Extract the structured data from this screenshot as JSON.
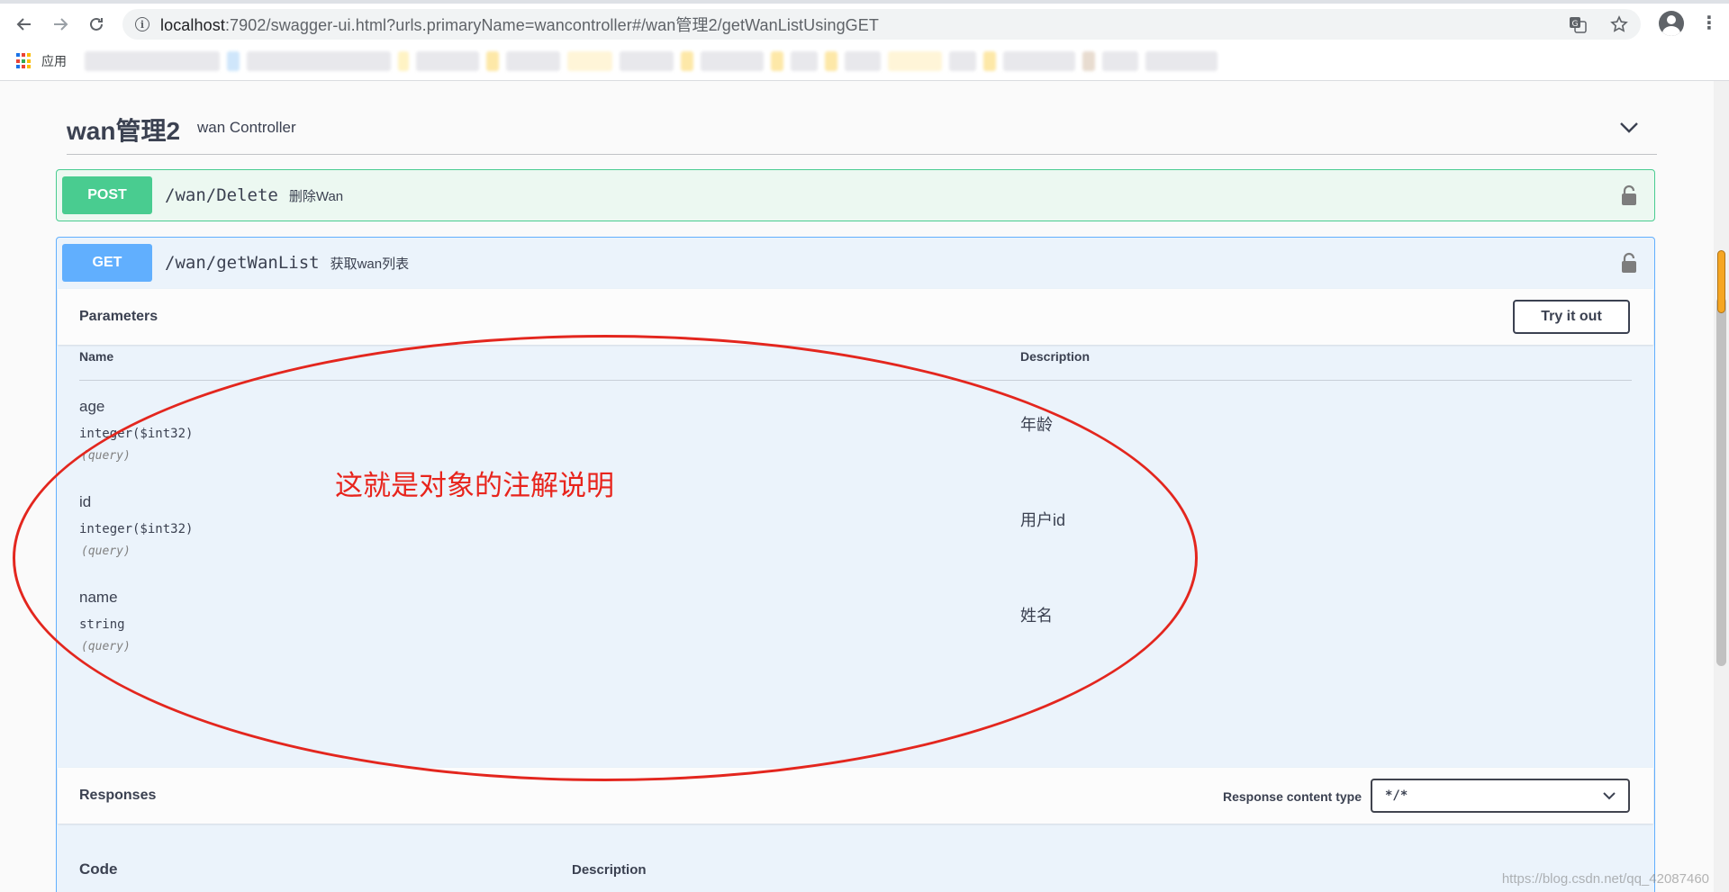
{
  "browser": {
    "url_host": "localhost",
    "url_rest": ":7902/swagger-ui.html?urls.primaryName=wancontroller#/wan管理2/getWanListUsingGET",
    "bookmark_apps_label": "应用"
  },
  "tag": {
    "name": "wan管理2",
    "description": "wan Controller"
  },
  "operations": {
    "post": {
      "method": "POST",
      "path": "/wan/Delete",
      "summary": "删除Wan"
    },
    "get": {
      "method": "GET",
      "path": "/wan/getWanList",
      "summary": "获取wan列表"
    }
  },
  "parameters": {
    "title": "Parameters",
    "try_it_out": "Try it out",
    "col_name": "Name",
    "col_description": "Description",
    "rows": [
      {
        "name": "age",
        "type": "integer($int32)",
        "in": "(query)",
        "description": "年龄"
      },
      {
        "name": "id",
        "type": "integer($int32)",
        "in": "(query)",
        "description": "用户id"
      },
      {
        "name": "name",
        "type": "string",
        "in": "(query)",
        "description": "姓名"
      }
    ]
  },
  "annotation": {
    "text": "这就是对象的注解说明",
    "color": "#e3261e"
  },
  "responses": {
    "title": "Responses",
    "content_type_label": "Response content type",
    "content_type_value": "*/*",
    "col_code": "Code",
    "col_description": "Description"
  },
  "watermark": "https://blog.csdn.net/qq_42087460",
  "colors": {
    "post": "#49cc90",
    "get": "#61affe",
    "post_bg": "#ecf8f1",
    "get_bg": "#ebf3fb"
  }
}
